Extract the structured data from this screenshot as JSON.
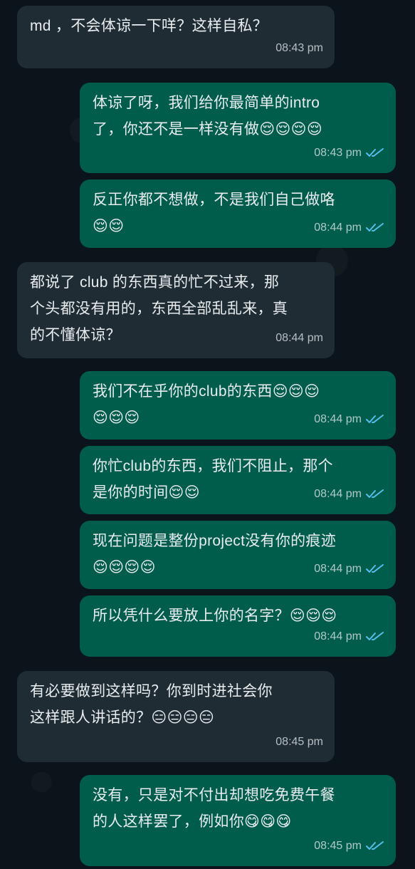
{
  "messages": [
    {
      "dir": "in",
      "text": "md ，不会体谅一下咩？这样自私？",
      "time": "08:43 pm"
    },
    {
      "dir": "out",
      "text": "体谅了呀，我们给你最简单的intro\n了，你还不是一样没有做😌😌😌😌",
      "time": "08:43 pm",
      "read": true
    },
    {
      "dir": "out",
      "text": "反正你都不想做，不是我们自己做咯\n😌😌",
      "time": "08:44 pm",
      "read": true
    },
    {
      "dir": "in",
      "text": "都说了 club 的东西真的忙不过来，那\n个头都没有用的，东西全部乱乱来，真\n的不懂体谅？",
      "time": "08:44 pm"
    },
    {
      "dir": "out",
      "text": "我们不在乎你的club的东西😌😌😌\n😌😌😌",
      "time": "08:44 pm",
      "read": true
    },
    {
      "dir": "out",
      "text": "你忙club的东西，我们不阻止，那个\n是你的时间😌😌",
      "time": "08:44 pm",
      "read": true
    },
    {
      "dir": "out",
      "text": "现在问题是整份project没有你的痕迹\n😌😌😌😌",
      "time": "08:44 pm",
      "read": true
    },
    {
      "dir": "out",
      "text": "所以凭什么要放上你的名字？😌😌😌",
      "time": "08:44 pm",
      "read": true
    },
    {
      "dir": "in",
      "text": "有必要做到这样吗？你到时进社会你\n这样跟人讲话的？😑😑😑😑",
      "time": "08:45 pm"
    },
    {
      "dir": "out",
      "text": "没有，只是对不付出却想吃免费午餐\n的人这样罢了，例如你😋😋😋",
      "time": "08:45 pm",
      "read": true
    }
  ],
  "colors": {
    "incoming": "#1f2c34",
    "outgoing": "#005c4b",
    "read_ticks": "#53bdeb",
    "background": "#0b141a"
  },
  "icons": {
    "read_receipt": "double-check-icon"
  }
}
